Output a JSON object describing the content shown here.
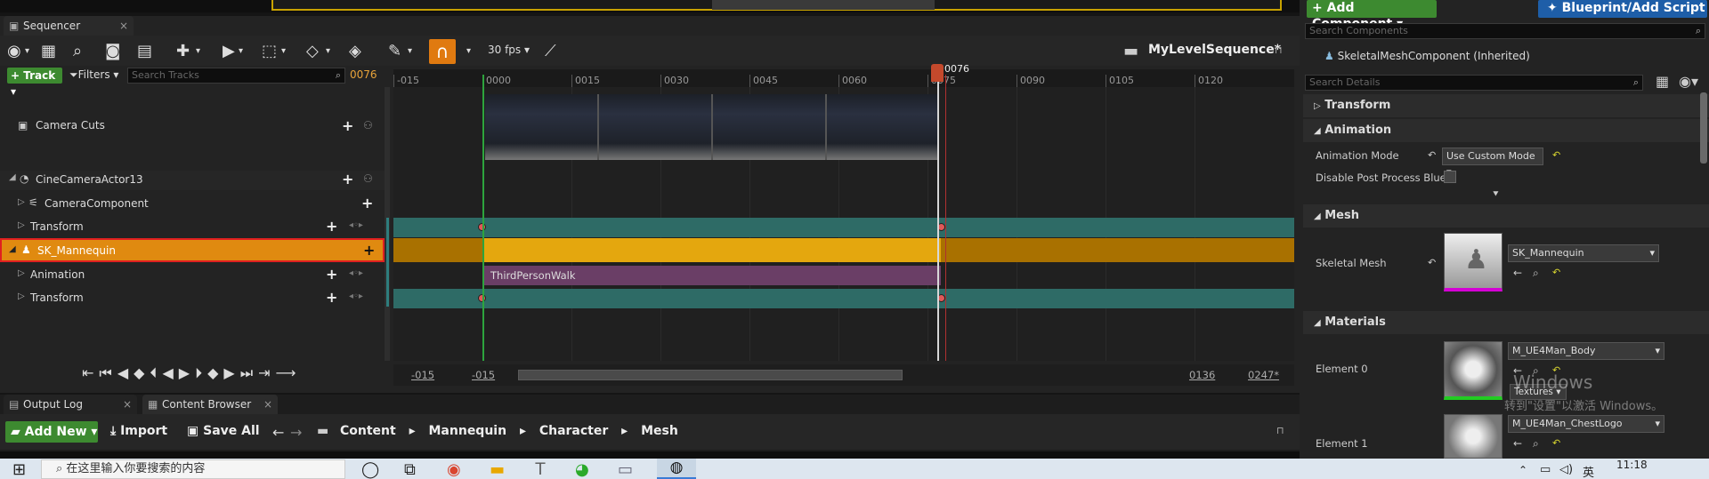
{
  "window": {
    "tab_sequencer": "Sequencer",
    "tab_output_log": "Output Log",
    "tab_content_browser": "Content Browser"
  },
  "toolbar": {
    "fps": "30 fps",
    "sequence_name": "MyLevelSequence*"
  },
  "tracks_bar": {
    "track_button": "Track",
    "filters_button": "Filters",
    "search_placeholder": "Search Tracks",
    "current_frame": "0076"
  },
  "tracks": [
    {
      "label": "Camera Cuts"
    },
    {
      "label": "CineCameraActor13"
    },
    {
      "label": "CameraComponent"
    },
    {
      "label": "Transform"
    },
    {
      "label": "SK_Mannequin"
    },
    {
      "label": "Animation"
    },
    {
      "label": "Transform"
    }
  ],
  "timeline": {
    "ticks": [
      "-015",
      "0000",
      "0015",
      "0030",
      "0045",
      "0060",
      "0075",
      "0090",
      "0105",
      "0120"
    ],
    "playhead_label": "0076",
    "anim_clip_label": "ThirdPersonWalk",
    "range_start_view": "-015",
    "range_start_work": "-015",
    "range_end_work": "0136",
    "range_end_view": "0247*"
  },
  "content_browser": {
    "add_new": "Add New",
    "import": "Import",
    "save_all": "Save All",
    "breadcrumb": [
      "Content",
      "Mannequin",
      "Character",
      "Mesh"
    ]
  },
  "details": {
    "add_component": "+ Add Component",
    "blueprint_script": "Blueprint/Add Script",
    "search_components_placeholder": "Search Components",
    "component_item": "SkeletalMeshComponent (Inherited)",
    "search_details_placeholder": "Search Details",
    "sections": {
      "transform": "Transform",
      "animation": "Animation",
      "mesh": "Mesh",
      "materials": "Materials"
    },
    "animation_mode_label": "Animation Mode",
    "animation_mode_value": "Use Custom Mode",
    "disable_post_label": "Disable Post Process Blue",
    "skeletal_mesh_label": "Skeletal Mesh",
    "skeletal_mesh_value": "SK_Mannequin",
    "element0_label": "Element 0",
    "element0_value": "M_UE4Man_Body",
    "element0_sub": "Textures",
    "element1_label": "Element 1",
    "element1_value": "M_UE4Man_ChestLogo",
    "watermark_line1": "Windows",
    "watermark_line2": "转到\"设置\"以激活 Windows。"
  },
  "taskbar": {
    "search_placeholder": "在这里输入你要搜索的内容",
    "time": "11:18",
    "ime": "英"
  }
}
